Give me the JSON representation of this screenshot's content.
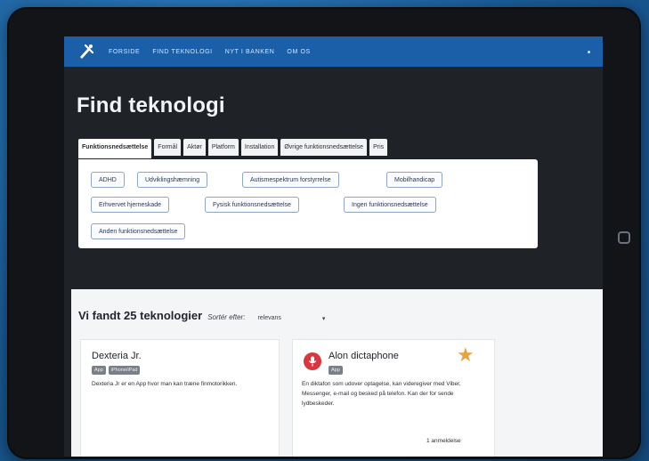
{
  "nav": {
    "links": [
      "FORSIDE",
      "FIND TEKNOLOGI",
      "NYT I BANKEN",
      "OM OS"
    ]
  },
  "page_title": "Find teknologi",
  "tabs": [
    "Funktionsnedsættelse",
    "Formål",
    "Aktør",
    "Platform",
    "Installation",
    "Øvrige funktionsnedsættelse",
    "Pris"
  ],
  "filters": [
    "ADHD",
    "Udviklingshæmning",
    "Autismespektrum forstyrrelse",
    "Mobilhandicap",
    "Erhvervet hjerneskade",
    "Fysisk funktionsnedsættelse",
    "Ingen funktionsnedsættelse",
    "Anden funktionsnedsættelse"
  ],
  "results": {
    "count_text": "Vi fandt 25 teknologier",
    "sort_label": "Sortér efter:",
    "sort_value": "relevans",
    "sort_caret": "▾"
  },
  "cards": [
    {
      "title": "Dexteria Jr.",
      "badges": [
        "App",
        "iPhone/iPad"
      ],
      "description": "Dexteria Jr er en App hvor man kan træne finmotorikken."
    },
    {
      "title": "Alon dictaphone",
      "badges": [
        "App"
      ],
      "description": "En diktafon som udover optagelse, kan videregiver med Viber, Messenger, e-mail og besked på telefon. Kan der for sende lydbeskeder.",
      "reviews": "1 anmeldelse",
      "icon": "microphone-icon",
      "favorite_icon": "star-icon",
      "accent_color": "#d9363e",
      "star_color": "#e8a43a"
    }
  ],
  "colors": {
    "nav_bg": "#1b5fa8",
    "screen_bg": "#1f2227",
    "chip_border": "#8da6c8"
  }
}
